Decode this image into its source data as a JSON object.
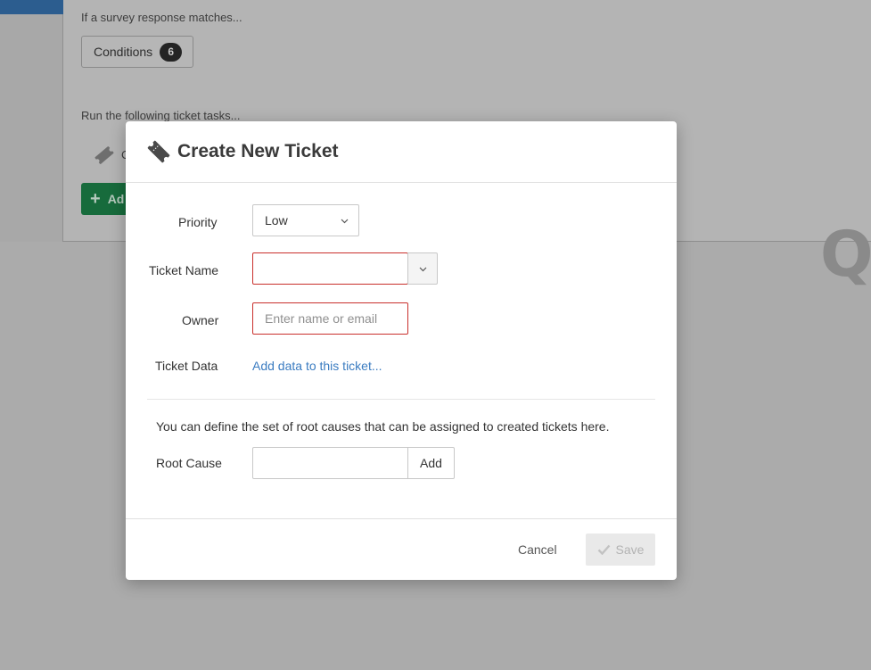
{
  "background": {
    "survey_match_text": "If a survey response matches...",
    "conditions_label": "Conditions",
    "conditions_count": "6",
    "run_tasks_text": "Run the following ticket tasks...",
    "task_partial_text": "C",
    "add_button_partial": "Ad",
    "logo_letter": "Q"
  },
  "modal": {
    "title": "Create New Ticket",
    "title_icon": "ticket-icon",
    "priority": {
      "label": "Priority",
      "value": "Low"
    },
    "ticket_name": {
      "label": "Ticket Name",
      "value": ""
    },
    "owner": {
      "label": "Owner",
      "value": "",
      "placeholder": "Enter name or email"
    },
    "ticket_data": {
      "label": "Ticket Data",
      "link": "Add data to this ticket..."
    },
    "root_cause": {
      "description": "You can define the set of root causes that can be assigned to created tickets here.",
      "label": "Root Cause",
      "value": "",
      "add_label": "Add"
    },
    "footer": {
      "cancel_label": "Cancel",
      "save_label": "Save"
    }
  },
  "colors": {
    "error_border": "#c9302c",
    "link": "#3b7cc1",
    "add_button_green": "#176b3c",
    "sidebar_active": "#2c5d8f"
  }
}
